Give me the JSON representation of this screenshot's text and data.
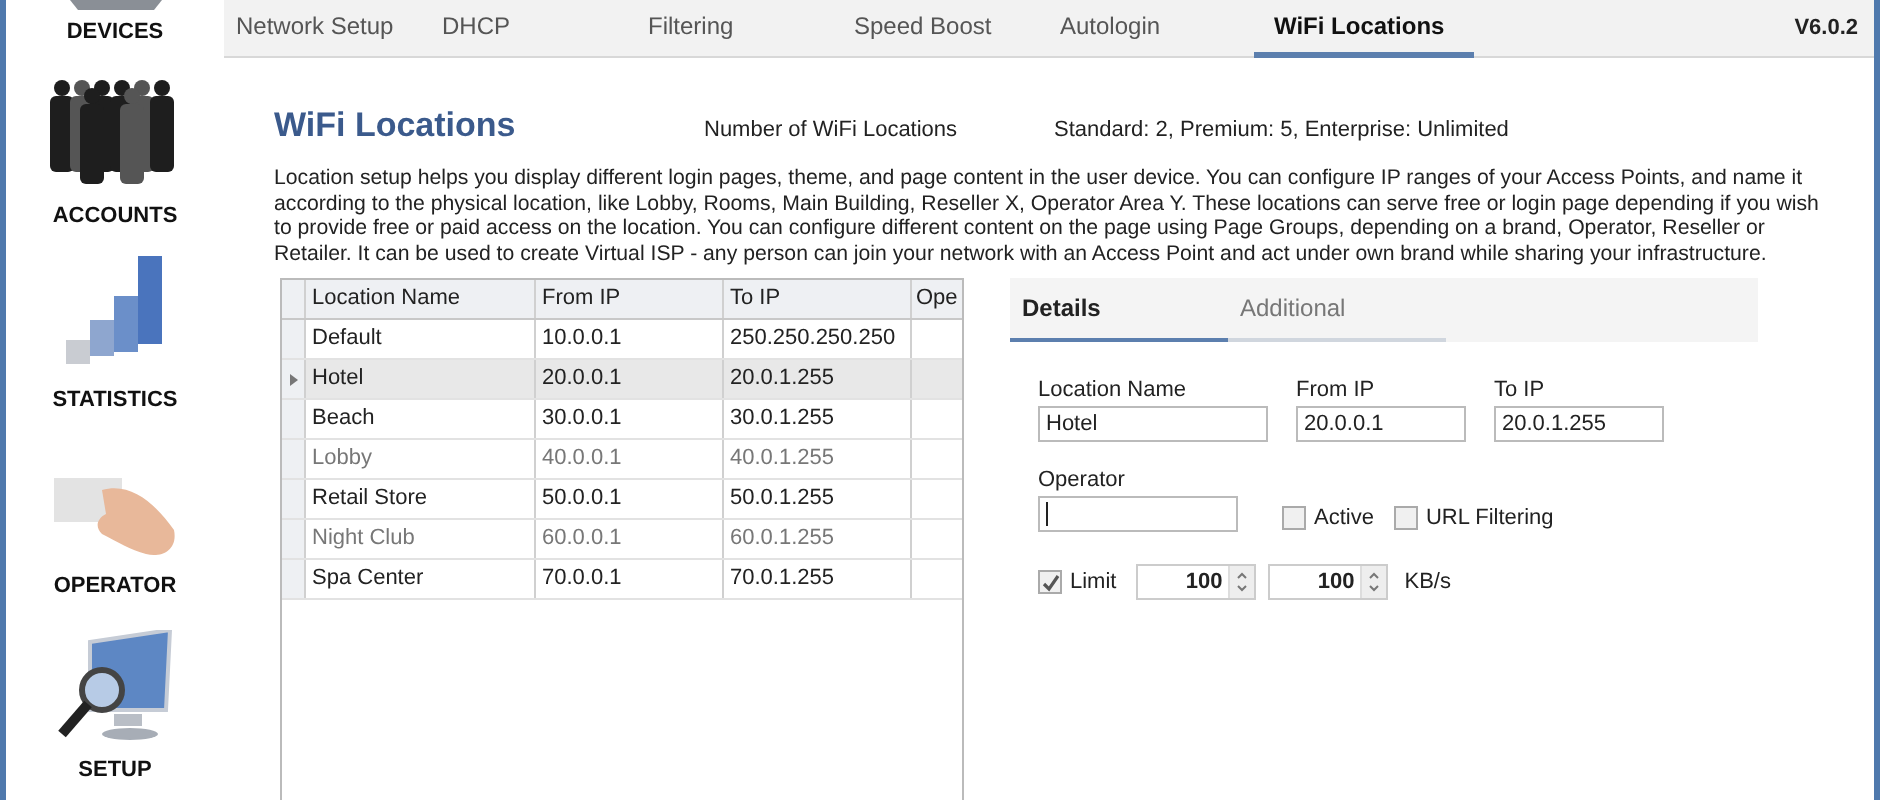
{
  "sidebar": {
    "items": [
      {
        "label": "DEVICES",
        "kind": "devices"
      },
      {
        "label": "ACCOUNTS",
        "kind": "accounts"
      },
      {
        "label": "STATISTICS",
        "kind": "statistics"
      },
      {
        "label": "OPERATOR",
        "kind": "operator"
      },
      {
        "label": "SETUP",
        "kind": "setup"
      }
    ]
  },
  "tabs": [
    {
      "label": "Network Setup",
      "selected": false
    },
    {
      "label": "DHCP",
      "selected": false
    },
    {
      "label": "Filtering",
      "selected": false
    },
    {
      "label": "Speed Boost",
      "selected": false
    },
    {
      "label": "Autologin",
      "selected": false
    },
    {
      "label": "WiFi Locations",
      "selected": true
    }
  ],
  "version": "V6.0.2",
  "page": {
    "title": "WiFi Locations",
    "limit_label": "Number of WiFi Locations",
    "limit_value": "Standard: 2, Premium: 5, Enterprise: Unlimited",
    "description": "Location setup helps you display different login pages, theme, and page content in the user device. You can configure IP ranges of your Access Points, and name it according to the physical location, like Lobby, Rooms, Main Building, Reseller X, Operator Area Y. These locations can serve free or login page depending if you wish to provide free or paid access on the location. You can configure different content on the page using Page Groups, depending on a brand, Operator, Reseller or Retailer. It can be used to create Virtual ISP - any person can join your network with an Access Point and act under own brand while sharing your infrastructure."
  },
  "table": {
    "columns": [
      "Location Name",
      "From IP",
      "To IP",
      "Ope"
    ],
    "rows": [
      {
        "cells": [
          "Default",
          "10.0.0.1",
          "250.250.250.250"
        ],
        "selected": false,
        "active": true
      },
      {
        "cells": [
          "Hotel",
          "20.0.0.1",
          "20.0.1.255"
        ],
        "selected": true,
        "active": true
      },
      {
        "cells": [
          "Beach",
          "30.0.0.1",
          "30.0.1.255"
        ],
        "selected": false,
        "active": true
      },
      {
        "cells": [
          "Lobby",
          "40.0.0.1",
          "40.0.1.255"
        ],
        "selected": false,
        "active": false
      },
      {
        "cells": [
          "Retail Store",
          "50.0.0.1",
          "50.0.1.255"
        ],
        "selected": false,
        "active": true
      },
      {
        "cells": [
          "Night Club",
          "60.0.0.1",
          "60.0.1.255"
        ],
        "selected": false,
        "active": false
      },
      {
        "cells": [
          "Spa Center",
          "70.0.0.1",
          "70.0.1.255"
        ],
        "selected": false,
        "active": true
      }
    ]
  },
  "details": {
    "tabs": [
      {
        "label": "Details",
        "selected": true
      },
      {
        "label": "Additional",
        "selected": false
      }
    ],
    "fields": [
      {
        "label": "Location Name",
        "value": "Hotel"
      },
      {
        "label": "From IP",
        "value": "20.0.0.1"
      },
      {
        "label": "To IP",
        "value": "20.0.1.255"
      }
    ],
    "operator": {
      "label": "Operator",
      "focused": true
    },
    "active": {
      "label": "Active",
      "checked": false
    },
    "url_filtering": {
      "label": "URL Filtering",
      "checked": false
    },
    "limit": {
      "label": "Limit",
      "checked": true,
      "values": [
        "100",
        "100"
      ],
      "unit": "KB/s"
    }
  }
}
